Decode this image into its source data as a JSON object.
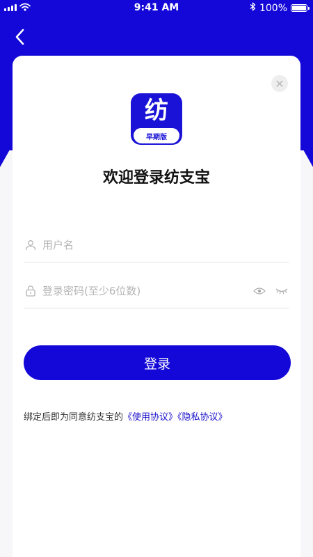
{
  "status_bar": {
    "time": "9:41 AM",
    "battery_percent": "100%",
    "battery_level": 1.0
  },
  "logo": {
    "char": "纺",
    "ribbon_text": "早期版"
  },
  "welcome_title": "欢迎登录纺支宝",
  "form": {
    "username_placeholder": "用户名",
    "username_value": "",
    "password_placeholder": "登录密码(至少6位数)",
    "password_value": ""
  },
  "login_button_label": "登录",
  "agreement": {
    "prefix": "绑定后即为同意纺支宝的",
    "terms_link": "《使用协议》",
    "privacy_link": "《隐私协议》"
  },
  "colors": {
    "brand_blue": "#1408d8",
    "link_blue": "#1a12c8"
  },
  "icons": {
    "back": "chevron-left-icon",
    "close": "close-icon",
    "user": "user-icon",
    "lock": "lock-icon",
    "eye_open": "eye-icon",
    "eye_closed": "eye-closed-icon",
    "signal": "signal-icon",
    "wifi": "wifi-icon",
    "bluetooth": "bluetooth-icon",
    "battery": "battery-icon"
  }
}
